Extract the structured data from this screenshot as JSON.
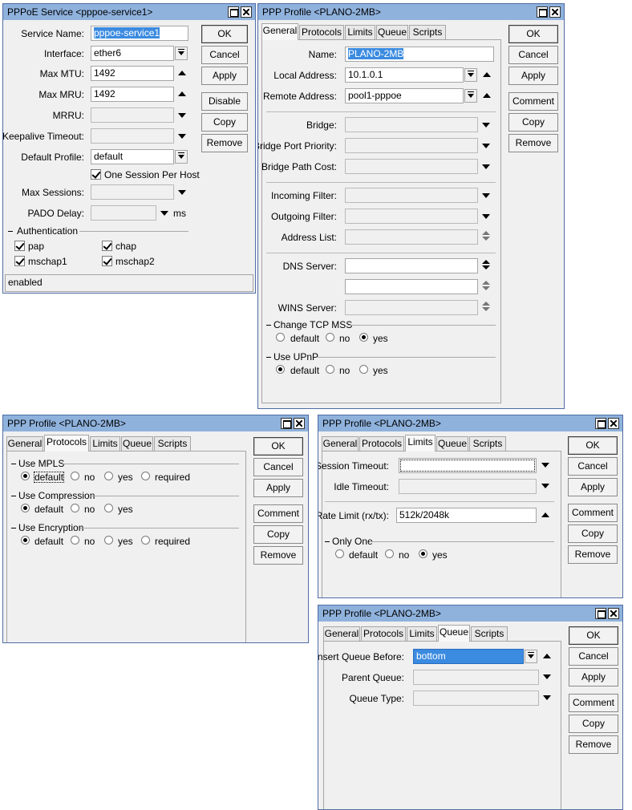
{
  "pppoe": {
    "title": "PPPoE Service <pppoe-service1>",
    "labels": {
      "service_name": "Service Name:",
      "interface": "Interface:",
      "max_mtu": "Max MTU:",
      "max_mru": "Max MRU:",
      "mrru": "MRRU:",
      "keepalive_timeout": "Keepalive Timeout:",
      "default_profile": "Default Profile:",
      "max_sessions": "Max Sessions:",
      "pado_delay": "PADO Delay:"
    },
    "values": {
      "service_name": "pppoe-service1",
      "interface": "ether6",
      "max_mtu": "1492",
      "max_mru": "1492",
      "mrru": "",
      "keepalive_timeout": "",
      "default_profile": "default",
      "max_sessions": "",
      "pado_delay": ""
    },
    "one_session_per_host": "One Session Per Host",
    "pado_unit": "ms",
    "authentication": {
      "title": "Authentication",
      "pap": "pap",
      "chap": "chap",
      "mschap1": "mschap1",
      "mschap2": "mschap2"
    },
    "status": "enabled",
    "buttons": {
      "ok": "OK",
      "cancel": "Cancel",
      "apply": "Apply",
      "disable": "Disable",
      "copy": "Copy",
      "remove": "Remove"
    }
  },
  "profile_general": {
    "title": "PPP Profile <PLANO-2MB>",
    "tabs": [
      "General",
      "Protocols",
      "Limits",
      "Queue",
      "Scripts"
    ],
    "labels": {
      "name": "Name:",
      "local_address": "Local Address:",
      "remote_address": "Remote Address:",
      "bridge": "Bridge:",
      "bridge_port_priority": "Bridge Port Priority:",
      "bridge_path_cost": "Bridge Path Cost:",
      "incoming_filter": "Incoming Filter:",
      "outgoing_filter": "Outgoing Filter:",
      "address_list": "Address List:",
      "dns_server": "DNS Server:",
      "wins_server": "WINS Server:"
    },
    "values": {
      "name": "PLANO-2MB",
      "local_address": "10.1.0.1",
      "remote_address": "pool1-pppoe"
    },
    "change_tcp_mss": {
      "title": "Change TCP MSS",
      "options": [
        "default",
        "no",
        "yes"
      ]
    },
    "use_upnp": {
      "title": "Use UPnP",
      "options": [
        "default",
        "no",
        "yes"
      ]
    },
    "buttons": {
      "ok": "OK",
      "cancel": "Cancel",
      "apply": "Apply",
      "comment": "Comment",
      "copy": "Copy",
      "remove": "Remove"
    }
  },
  "profile_protocols": {
    "title": "PPP Profile <PLANO-2MB>",
    "tabs": [
      "General",
      "Protocols",
      "Limits",
      "Queue",
      "Scripts"
    ],
    "use_mpls": {
      "title": "Use MPLS",
      "options": [
        "default",
        "no",
        "yes",
        "required"
      ]
    },
    "use_compression": {
      "title": "Use Compression",
      "options": [
        "default",
        "no",
        "yes"
      ]
    },
    "use_encryption": {
      "title": "Use Encryption",
      "options": [
        "default",
        "no",
        "yes",
        "required"
      ]
    },
    "buttons": {
      "ok": "OK",
      "cancel": "Cancel",
      "apply": "Apply",
      "comment": "Comment",
      "copy": "Copy",
      "remove": "Remove"
    }
  },
  "profile_limits": {
    "title": "PPP Profile <PLANO-2MB>",
    "tabs": [
      "General",
      "Protocols",
      "Limits",
      "Queue",
      "Scripts"
    ],
    "labels": {
      "session_timeout": "Session Timeout:",
      "idle_timeout": "Idle Timeout:",
      "rate_limit": "Rate Limit (rx/tx):"
    },
    "values": {
      "rate_limit": "512k/2048k"
    },
    "only_one": {
      "title": "Only One",
      "options": [
        "default",
        "no",
        "yes"
      ]
    },
    "buttons": {
      "ok": "OK",
      "cancel": "Cancel",
      "apply": "Apply",
      "comment": "Comment",
      "copy": "Copy",
      "remove": "Remove"
    }
  },
  "profile_queue": {
    "title": "PPP Profile <PLANO-2MB>",
    "tabs": [
      "General",
      "Protocols",
      "Limits",
      "Queue",
      "Scripts"
    ],
    "labels": {
      "insert_queue_before": "Insert Queue Before:",
      "parent_queue": "Parent Queue:",
      "queue_type": "Queue Type:"
    },
    "values": {
      "insert_queue_before": "bottom"
    },
    "buttons": {
      "ok": "OK",
      "cancel": "Cancel",
      "apply": "Apply",
      "comment": "Comment",
      "copy": "Copy",
      "remove": "Remove"
    }
  }
}
